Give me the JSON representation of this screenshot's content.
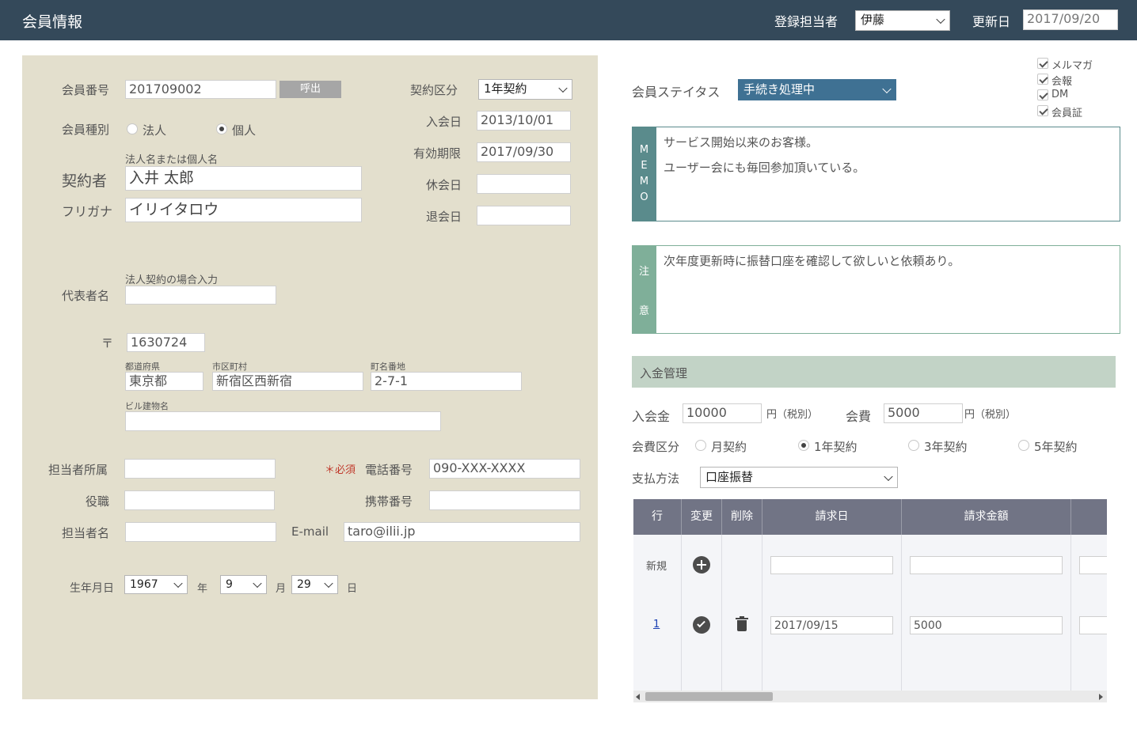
{
  "header": {
    "title": "会員情報",
    "registrar_label": "登録担当者",
    "registrar_value": "伊藤",
    "updated_label": "更新日",
    "updated_value": "2017/09/20"
  },
  "member": {
    "number_label": "会員番号",
    "number_value": "201709002",
    "call_button": "呼出",
    "type_label": "会員種別",
    "type_corp": "法人",
    "type_person": "個人",
    "name_hint": "法人名または個人名",
    "contractor_label": "契約者",
    "contractor_value": "入井 太郎",
    "kana_label": "フリガナ",
    "kana_value": "イリイタロウ",
    "rep_hint": "法人契約の場合入力",
    "rep_label": "代表者名",
    "rep_value": "",
    "postal_mark": "〒",
    "postal_value": "1630724",
    "pref_label": "都道府県",
    "pref_value": "東京都",
    "city_label": "市区町村",
    "city_value": "新宿区西新宿",
    "town_label": "町名番地",
    "town_value": "2-7-1",
    "building_label": "ビル建物名",
    "building_value": "",
    "dept_label": "担当者所属",
    "dept_value": "",
    "required_label": "＊必須",
    "phone_label": "電話番号",
    "phone_value": "090-XXX-XXXX",
    "title_label": "役職",
    "title_value": "",
    "mobile_label": "携帯番号",
    "mobile_value": "",
    "person_label": "担当者名",
    "person_value": "",
    "email_label": "E-mail",
    "email_value": "taro@ilii.jp",
    "birth_label": "生年月日",
    "birth_year": "1967",
    "year_unit": "年",
    "birth_month": "9",
    "month_unit": "月",
    "birth_day": "29",
    "day_unit": "日"
  },
  "contract": {
    "type_label": "契約区分",
    "type_value": "1年契約",
    "join_label": "入会日",
    "join_value": "2013/10/01",
    "expiry_label": "有効期限",
    "expiry_value": "2017/09/30",
    "suspend_label": "休会日",
    "suspend_value": "",
    "withdraw_label": "退会日",
    "withdraw_value": ""
  },
  "status": {
    "label": "会員ステイタス",
    "value": "手続き処理中",
    "checks": [
      "メルマガ",
      "会報",
      "DM",
      "会員証"
    ]
  },
  "memo": {
    "side": [
      "M",
      "E",
      "M",
      "O"
    ],
    "line1": "サービス開始以来のお客様。",
    "line2": "ユーザー会にも毎回参加頂いている。"
  },
  "caution": {
    "side": [
      "注",
      "意"
    ],
    "text": "次年度更新時に振替口座を確認して欲しいと依頼あり。"
  },
  "payment": {
    "section_title": "入金管理",
    "join_fee_label": "入会金",
    "join_fee_value": "10000",
    "yen_tax": "円（税別）",
    "fee_label": "会費",
    "fee_value": "5000",
    "fee_type_label": "会費区分",
    "fee_types": [
      "月契約",
      "1年契約",
      "3年契約",
      "5年契約"
    ],
    "method_label": "支払方法",
    "method_value": "口座振替"
  },
  "table": {
    "headers": [
      "行",
      "変更",
      "削除",
      "請求日",
      "請求金額"
    ],
    "new_label": "新規",
    "rows": [
      {
        "no": "1",
        "date": "2017/09/15",
        "amount": "5000"
      }
    ]
  }
}
